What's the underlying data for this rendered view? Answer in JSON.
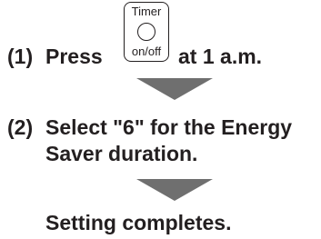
{
  "step1": {
    "number": "(1)",
    "press_word": "Press",
    "suffix": "at 1 a.m.",
    "key_button": {
      "top_label": "Timer",
      "bottom_label": "on/off"
    }
  },
  "step2": {
    "number": "(2)",
    "line1": "Select \"6\" for the Energy",
    "line2": "Saver duration."
  },
  "result": {
    "text": "Setting completes."
  },
  "colors": {
    "text": "#231f20",
    "arrow": "#6f6f6f",
    "background": "#ffffff"
  }
}
